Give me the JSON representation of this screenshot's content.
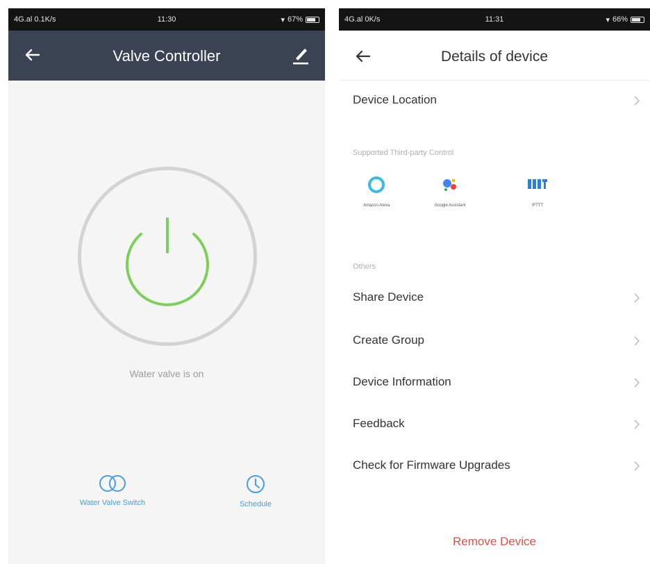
{
  "left_screen": {
    "status_bar": {
      "left": "4G.al 0.1K/s",
      "time": "11:30",
      "right": "67%"
    },
    "header": {
      "title": "Valve Controller"
    },
    "power": {
      "status_text": "Water valve is on",
      "state": "on"
    },
    "actions": [
      {
        "label": "Water Valve Switch",
        "icon": "toggle-icon"
      },
      {
        "label": "Schedule",
        "icon": "clock-icon"
      }
    ]
  },
  "right_screen": {
    "status_bar": {
      "left": "4G.al 0K/s",
      "time": "11:31",
      "right": "66%"
    },
    "header": {
      "title": "Details of device"
    },
    "device_location": "Device Location",
    "third_party": {
      "section_label": "Supported Third-party Control",
      "items": [
        {
          "name": "Amazon Alexa",
          "icon": "alexa-icon"
        },
        {
          "name": "Google Assistant",
          "icon": "google-assistant-icon"
        },
        {
          "name": "IFTTT",
          "icon": "ifttt-icon"
        }
      ]
    },
    "others": {
      "section_label": "Others",
      "items": [
        "Share Device",
        "Create Group",
        "Device Information",
        "Feedback",
        "Check for Firmware Upgrades"
      ]
    },
    "remove_label": "Remove Device"
  },
  "colors": {
    "header_dark": "#3b4253",
    "power_green": "#7ccf5a",
    "accent_blue": "#4a9de0",
    "danger_red": "#e0504b"
  }
}
